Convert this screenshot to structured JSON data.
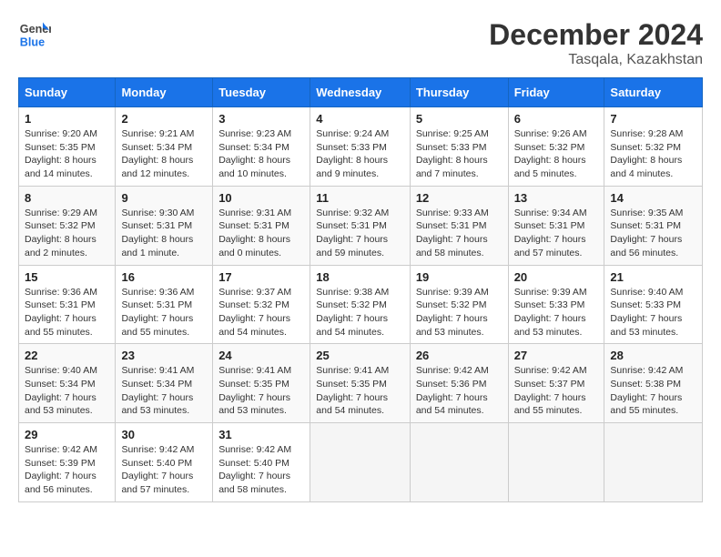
{
  "header": {
    "logo_general": "General",
    "logo_blue": "Blue",
    "month": "December 2024",
    "location": "Tasqala, Kazakhstan"
  },
  "weekdays": [
    "Sunday",
    "Monday",
    "Tuesday",
    "Wednesday",
    "Thursday",
    "Friday",
    "Saturday"
  ],
  "weeks": [
    [
      {
        "day": "1",
        "sunrise": "9:20 AM",
        "sunset": "5:35 PM",
        "daylight": "8 hours and 14 minutes."
      },
      {
        "day": "2",
        "sunrise": "9:21 AM",
        "sunset": "5:34 PM",
        "daylight": "8 hours and 12 minutes."
      },
      {
        "day": "3",
        "sunrise": "9:23 AM",
        "sunset": "5:34 PM",
        "daylight": "8 hours and 10 minutes."
      },
      {
        "day": "4",
        "sunrise": "9:24 AM",
        "sunset": "5:33 PM",
        "daylight": "8 hours and 9 minutes."
      },
      {
        "day": "5",
        "sunrise": "9:25 AM",
        "sunset": "5:33 PM",
        "daylight": "8 hours and 7 minutes."
      },
      {
        "day": "6",
        "sunrise": "9:26 AM",
        "sunset": "5:32 PM",
        "daylight": "8 hours and 5 minutes."
      },
      {
        "day": "7",
        "sunrise": "9:28 AM",
        "sunset": "5:32 PM",
        "daylight": "8 hours and 4 minutes."
      }
    ],
    [
      {
        "day": "8",
        "sunrise": "9:29 AM",
        "sunset": "5:32 PM",
        "daylight": "8 hours and 2 minutes."
      },
      {
        "day": "9",
        "sunrise": "9:30 AM",
        "sunset": "5:31 PM",
        "daylight": "8 hours and 1 minute."
      },
      {
        "day": "10",
        "sunrise": "9:31 AM",
        "sunset": "5:31 PM",
        "daylight": "8 hours and 0 minutes."
      },
      {
        "day": "11",
        "sunrise": "9:32 AM",
        "sunset": "5:31 PM",
        "daylight": "7 hours and 59 minutes."
      },
      {
        "day": "12",
        "sunrise": "9:33 AM",
        "sunset": "5:31 PM",
        "daylight": "7 hours and 58 minutes."
      },
      {
        "day": "13",
        "sunrise": "9:34 AM",
        "sunset": "5:31 PM",
        "daylight": "7 hours and 57 minutes."
      },
      {
        "day": "14",
        "sunrise": "9:35 AM",
        "sunset": "5:31 PM",
        "daylight": "7 hours and 56 minutes."
      }
    ],
    [
      {
        "day": "15",
        "sunrise": "9:36 AM",
        "sunset": "5:31 PM",
        "daylight": "7 hours and 55 minutes."
      },
      {
        "day": "16",
        "sunrise": "9:36 AM",
        "sunset": "5:31 PM",
        "daylight": "7 hours and 55 minutes."
      },
      {
        "day": "17",
        "sunrise": "9:37 AM",
        "sunset": "5:32 PM",
        "daylight": "7 hours and 54 minutes."
      },
      {
        "day": "18",
        "sunrise": "9:38 AM",
        "sunset": "5:32 PM",
        "daylight": "7 hours and 54 minutes."
      },
      {
        "day": "19",
        "sunrise": "9:39 AM",
        "sunset": "5:32 PM",
        "daylight": "7 hours and 53 minutes."
      },
      {
        "day": "20",
        "sunrise": "9:39 AM",
        "sunset": "5:33 PM",
        "daylight": "7 hours and 53 minutes."
      },
      {
        "day": "21",
        "sunrise": "9:40 AM",
        "sunset": "5:33 PM",
        "daylight": "7 hours and 53 minutes."
      }
    ],
    [
      {
        "day": "22",
        "sunrise": "9:40 AM",
        "sunset": "5:34 PM",
        "daylight": "7 hours and 53 minutes."
      },
      {
        "day": "23",
        "sunrise": "9:41 AM",
        "sunset": "5:34 PM",
        "daylight": "7 hours and 53 minutes."
      },
      {
        "day": "24",
        "sunrise": "9:41 AM",
        "sunset": "5:35 PM",
        "daylight": "7 hours and 53 minutes."
      },
      {
        "day": "25",
        "sunrise": "9:41 AM",
        "sunset": "5:35 PM",
        "daylight": "7 hours and 54 minutes."
      },
      {
        "day": "26",
        "sunrise": "9:42 AM",
        "sunset": "5:36 PM",
        "daylight": "7 hours and 54 minutes."
      },
      {
        "day": "27",
        "sunrise": "9:42 AM",
        "sunset": "5:37 PM",
        "daylight": "7 hours and 55 minutes."
      },
      {
        "day": "28",
        "sunrise": "9:42 AM",
        "sunset": "5:38 PM",
        "daylight": "7 hours and 55 minutes."
      }
    ],
    [
      {
        "day": "29",
        "sunrise": "9:42 AM",
        "sunset": "5:39 PM",
        "daylight": "7 hours and 56 minutes."
      },
      {
        "day": "30",
        "sunrise": "9:42 AM",
        "sunset": "5:40 PM",
        "daylight": "7 hours and 57 minutes."
      },
      {
        "day": "31",
        "sunrise": "9:42 AM",
        "sunset": "5:40 PM",
        "daylight": "7 hours and 58 minutes."
      },
      null,
      null,
      null,
      null
    ]
  ]
}
